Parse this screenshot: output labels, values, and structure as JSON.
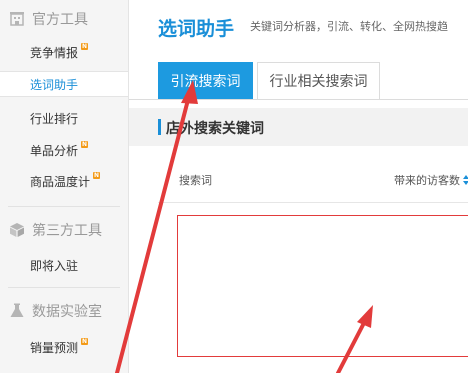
{
  "sidebar": {
    "groups": [
      {
        "title": "官方工具",
        "icon": "building-icon"
      },
      {
        "title": "第三方工具",
        "icon": "cube-icon"
      },
      {
        "title": "数据实验室",
        "icon": "flask-icon"
      }
    ],
    "items": [
      {
        "label": "竞争情报",
        "badge": "N"
      },
      {
        "label": "选词助手",
        "active": true
      },
      {
        "label": "行业排行"
      },
      {
        "label": "单品分析",
        "badge": "N"
      },
      {
        "label": "商品温度计",
        "badge": "N"
      },
      {
        "label": "即将入驻"
      },
      {
        "label": "销量预测",
        "badge": "N"
      }
    ]
  },
  "header": {
    "title": "选词助手",
    "subtitle": "关键词分析器，引流、转化、全网热搜趋"
  },
  "tabs": [
    {
      "label": "引流搜索词",
      "active": true
    },
    {
      "label": "行业相关搜索词",
      "active": false
    }
  ],
  "section": {
    "title": "店外搜索关键词"
  },
  "table": {
    "columns": [
      {
        "label": "搜索词"
      },
      {
        "label": "带来的访客数",
        "sortable": true
      }
    ],
    "rows": []
  },
  "colors": {
    "accent": "#1a8fd8",
    "tab_active_bg": "#1d9ae0",
    "badge": "#f39a17",
    "annotation_red": "#e23b3b"
  }
}
